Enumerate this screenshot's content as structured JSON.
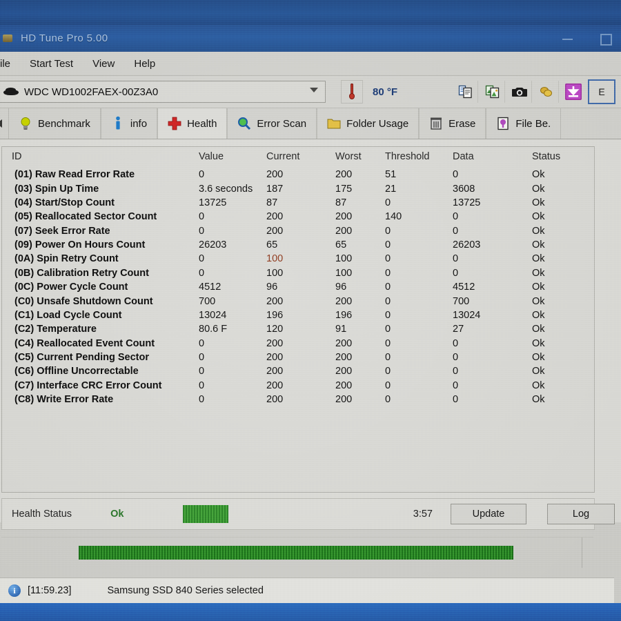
{
  "window": {
    "title": "HD Tune Pro 5.00",
    "app_icon": "hdd-icon",
    "minimize_label": "minimize",
    "maximize_label": "maximize"
  },
  "menu": {
    "items": [
      {
        "label": "ile",
        "name": "menu-file"
      },
      {
        "label": "Start Test",
        "name": "menu-start-test"
      },
      {
        "label": "View",
        "name": "menu-view"
      },
      {
        "label": "Help",
        "name": "menu-help"
      }
    ]
  },
  "drivebar": {
    "selected_drive": "WDC WD1002FAEX-00Z3A0",
    "drive_icon": "hard-disk-icon",
    "dropdown_icon": "chevron-down-icon",
    "temperature_icon": "thermometer-icon",
    "temperature": "80 °F",
    "tool_icons": [
      {
        "name": "copy-text-icon",
        "label": "Copy text"
      },
      {
        "name": "copy-image-icon",
        "label": "Copy image"
      },
      {
        "name": "screenshot-camera-icon",
        "label": "Screenshot"
      },
      {
        "name": "coins-icon",
        "label": "Donate"
      },
      {
        "name": "download-save-icon",
        "label": "Save"
      }
    ],
    "edge_button_label": "E"
  },
  "tabs": {
    "scroll_left_icon": "chevron-left-icon",
    "items": [
      {
        "label": "Benchmark",
        "icon": "lightbulb-icon",
        "active": false
      },
      {
        "label": "info",
        "icon": "info-pillar-icon",
        "active": false
      },
      {
        "label": "Health",
        "icon": "red-cross-icon",
        "active": true
      },
      {
        "label": "Error Scan",
        "icon": "magnifier-icon",
        "active": false
      },
      {
        "label": "Folder Usage",
        "icon": "folder-icon",
        "active": false
      },
      {
        "label": "Erase",
        "icon": "trash-icon",
        "active": false
      },
      {
        "label": "File Be.",
        "icon": "file-benchmark-icon",
        "active": false
      }
    ]
  },
  "table": {
    "columns": [
      "ID",
      "Value",
      "Current",
      "Worst",
      "Threshold",
      "Data",
      "Status"
    ],
    "rows": [
      {
        "id": "(01) Raw Read Error Rate",
        "value": "0",
        "current": "200",
        "worst": "200",
        "threshold": "51",
        "data": "0",
        "status": "Ok"
      },
      {
        "id": "(03) Spin Up Time",
        "value": "3.6 seconds",
        "current": "187",
        "worst": "175",
        "threshold": "21",
        "data": "3608",
        "status": "Ok"
      },
      {
        "id": "(04) Start/Stop Count",
        "value": "13725",
        "current": "87",
        "worst": "87",
        "threshold": "0",
        "data": "13725",
        "status": "Ok"
      },
      {
        "id": "(05) Reallocated Sector Count",
        "value": "0",
        "current": "200",
        "worst": "200",
        "threshold": "140",
        "data": "0",
        "status": "Ok"
      },
      {
        "id": "(07) Seek Error Rate",
        "value": "0",
        "current": "200",
        "worst": "200",
        "threshold": "0",
        "data": "0",
        "status": "Ok"
      },
      {
        "id": "(09) Power On Hours Count",
        "value": "26203",
        "current": "65",
        "worst": "65",
        "threshold": "0",
        "data": "26203",
        "status": "Ok"
      },
      {
        "id": "(0A) Spin Retry Count",
        "value": "0",
        "current": "100",
        "worst": "100",
        "threshold": "0",
        "data": "0",
        "status": "Ok"
      },
      {
        "id": "(0B) Calibration Retry Count",
        "value": "0",
        "current": "100",
        "worst": "100",
        "threshold": "0",
        "data": "0",
        "status": "Ok"
      },
      {
        "id": "(0C) Power Cycle Count",
        "value": "4512",
        "current": "96",
        "worst": "96",
        "threshold": "0",
        "data": "4512",
        "status": "Ok"
      },
      {
        "id": "(C0) Unsafe Shutdown Count",
        "value": "700",
        "current": "200",
        "worst": "200",
        "threshold": "0",
        "data": "700",
        "status": "Ok"
      },
      {
        "id": "(C1) Load Cycle Count",
        "value": "13024",
        "current": "196",
        "worst": "196",
        "threshold": "0",
        "data": "13024",
        "status": "Ok"
      },
      {
        "id": "(C2) Temperature",
        "value": "80.6 F",
        "current": "120",
        "worst": "91",
        "threshold": "0",
        "data": "27",
        "status": "Ok"
      },
      {
        "id": "(C4) Reallocated Event Count",
        "value": "0",
        "current": "200",
        "worst": "200",
        "threshold": "0",
        "data": "0",
        "status": "Ok"
      },
      {
        "id": "(C5) Current Pending Sector",
        "value": "0",
        "current": "200",
        "worst": "200",
        "threshold": "0",
        "data": "0",
        "status": "Ok"
      },
      {
        "id": "(C6) Offline Uncorrectable",
        "value": "0",
        "current": "200",
        "worst": "200",
        "threshold": "0",
        "data": "0",
        "status": "Ok"
      },
      {
        "id": "(C7) Interface CRC Error Count",
        "value": "0",
        "current": "200",
        "worst": "200",
        "threshold": "0",
        "data": "0",
        "status": "Ok"
      },
      {
        "id": "(C8) Write Error Rate",
        "value": "0",
        "current": "200",
        "worst": "200",
        "threshold": "0",
        "data": "0",
        "status": "Ok"
      }
    ]
  },
  "footer": {
    "health_label": "Health Status",
    "health_value": "Ok",
    "timer": "3:57",
    "update_button": "Update",
    "log_button": "Log",
    "progress_percent": 100
  },
  "statusbar": {
    "info_icon": "info-icon",
    "timestamp": "[11:59.23]",
    "message": "Samsung SSD 840 Series selected"
  },
  "colors": {
    "titlebar": "#2f63a6",
    "window_face": "#d2d2ce",
    "health_ok": "#2f7d2f",
    "progress_green": "#2f8a2b",
    "temperature_text": "#1f3f7a",
    "desktop_blue": "#2b5c9c"
  }
}
